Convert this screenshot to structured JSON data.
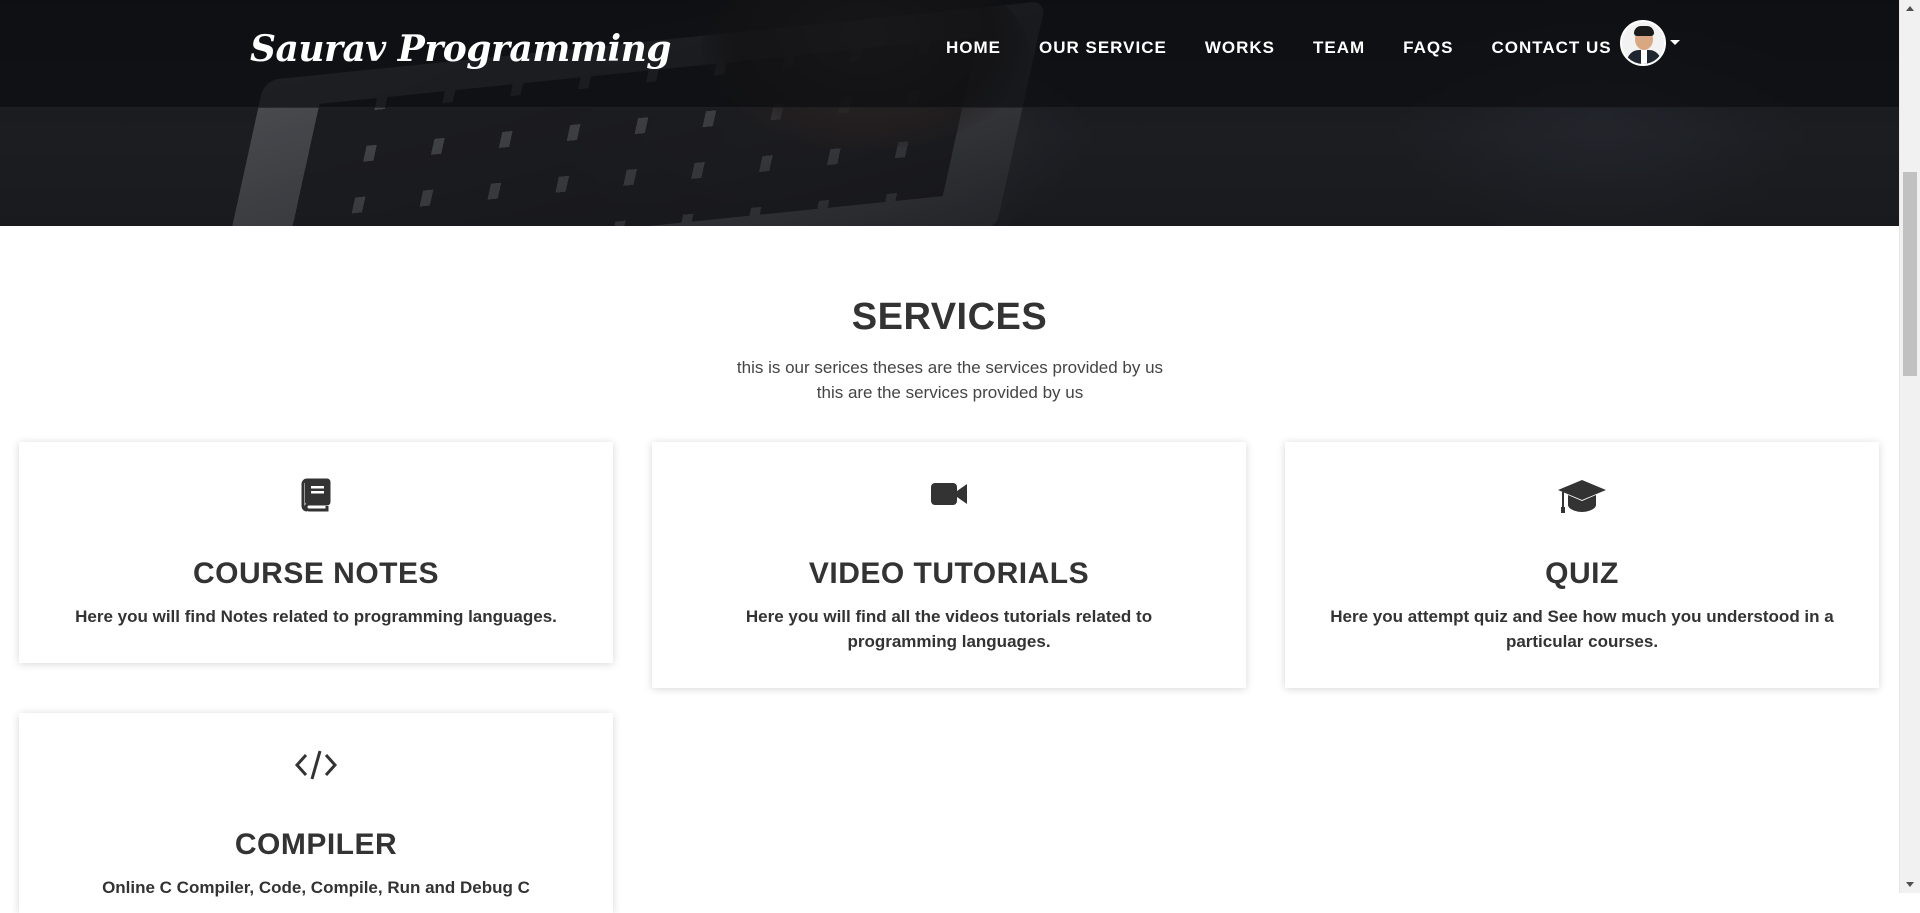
{
  "brand": {
    "name": "Saurav Programming"
  },
  "nav": {
    "items": [
      {
        "label": "HOME"
      },
      {
        "label": "OUR SERVICE"
      },
      {
        "label": "WORKS"
      },
      {
        "label": "TEAM"
      },
      {
        "label": "FAQS"
      },
      {
        "label": "CONTACT US"
      }
    ]
  },
  "services": {
    "title": "SERVICES",
    "subtitle_line1": "this is our serices theses are the services provided by us",
    "subtitle_line2": "this are the services provided by us",
    "cards": [
      {
        "icon": "book-icon",
        "title": "COURSE NOTES",
        "description": "Here you will find Notes related to programming languages."
      },
      {
        "icon": "video-camera-icon",
        "title": "VIDEO TUTORIALS",
        "description": "Here you will find all the videos tutorials related to programming languages."
      },
      {
        "icon": "graduation-cap-icon",
        "title": "QUIZ",
        "description": "Here you attempt quiz and See how much you understood in a particular courses."
      },
      {
        "icon": "code-icon",
        "title": "COMPILER",
        "description": "Online C Compiler, Code, Compile, Run and Debug C"
      }
    ]
  },
  "colors": {
    "navbar_bg": "#0c0e11",
    "text_dark": "#333333",
    "card_bg": "#ffffff"
  }
}
